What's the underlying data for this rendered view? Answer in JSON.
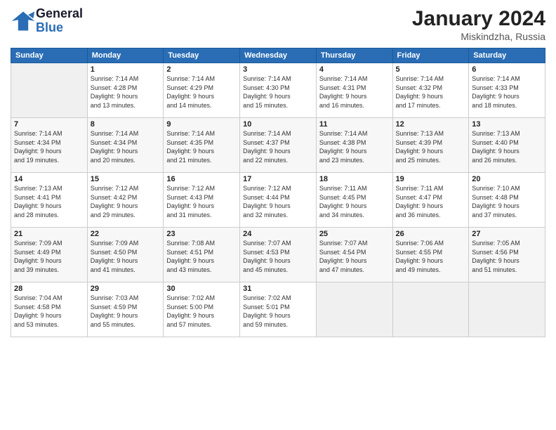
{
  "header": {
    "logo": {
      "line1": "General",
      "line2": "Blue"
    },
    "title": "January 2024",
    "location": "Miskindzha, Russia"
  },
  "calendar": {
    "days_of_week": [
      "Sunday",
      "Monday",
      "Tuesday",
      "Wednesday",
      "Thursday",
      "Friday",
      "Saturday"
    ],
    "weeks": [
      [
        {
          "day": "",
          "info": ""
        },
        {
          "day": "1",
          "info": "Sunrise: 7:14 AM\nSunset: 4:28 PM\nDaylight: 9 hours\nand 13 minutes."
        },
        {
          "day": "2",
          "info": "Sunrise: 7:14 AM\nSunset: 4:29 PM\nDaylight: 9 hours\nand 14 minutes."
        },
        {
          "day": "3",
          "info": "Sunrise: 7:14 AM\nSunset: 4:30 PM\nDaylight: 9 hours\nand 15 minutes."
        },
        {
          "day": "4",
          "info": "Sunrise: 7:14 AM\nSunset: 4:31 PM\nDaylight: 9 hours\nand 16 minutes."
        },
        {
          "day": "5",
          "info": "Sunrise: 7:14 AM\nSunset: 4:32 PM\nDaylight: 9 hours\nand 17 minutes."
        },
        {
          "day": "6",
          "info": "Sunrise: 7:14 AM\nSunset: 4:33 PM\nDaylight: 9 hours\nand 18 minutes."
        }
      ],
      [
        {
          "day": "7",
          "info": "Sunrise: 7:14 AM\nSunset: 4:34 PM\nDaylight: 9 hours\nand 19 minutes."
        },
        {
          "day": "8",
          "info": "Sunrise: 7:14 AM\nSunset: 4:34 PM\nDaylight: 9 hours\nand 20 minutes."
        },
        {
          "day": "9",
          "info": "Sunrise: 7:14 AM\nSunset: 4:35 PM\nDaylight: 9 hours\nand 21 minutes."
        },
        {
          "day": "10",
          "info": "Sunrise: 7:14 AM\nSunset: 4:37 PM\nDaylight: 9 hours\nand 22 minutes."
        },
        {
          "day": "11",
          "info": "Sunrise: 7:14 AM\nSunset: 4:38 PM\nDaylight: 9 hours\nand 23 minutes."
        },
        {
          "day": "12",
          "info": "Sunrise: 7:13 AM\nSunset: 4:39 PM\nDaylight: 9 hours\nand 25 minutes."
        },
        {
          "day": "13",
          "info": "Sunrise: 7:13 AM\nSunset: 4:40 PM\nDaylight: 9 hours\nand 26 minutes."
        }
      ],
      [
        {
          "day": "14",
          "info": "Sunrise: 7:13 AM\nSunset: 4:41 PM\nDaylight: 9 hours\nand 28 minutes."
        },
        {
          "day": "15",
          "info": "Sunrise: 7:12 AM\nSunset: 4:42 PM\nDaylight: 9 hours\nand 29 minutes."
        },
        {
          "day": "16",
          "info": "Sunrise: 7:12 AM\nSunset: 4:43 PM\nDaylight: 9 hours\nand 31 minutes."
        },
        {
          "day": "17",
          "info": "Sunrise: 7:12 AM\nSunset: 4:44 PM\nDaylight: 9 hours\nand 32 minutes."
        },
        {
          "day": "18",
          "info": "Sunrise: 7:11 AM\nSunset: 4:45 PM\nDaylight: 9 hours\nand 34 minutes."
        },
        {
          "day": "19",
          "info": "Sunrise: 7:11 AM\nSunset: 4:47 PM\nDaylight: 9 hours\nand 36 minutes."
        },
        {
          "day": "20",
          "info": "Sunrise: 7:10 AM\nSunset: 4:48 PM\nDaylight: 9 hours\nand 37 minutes."
        }
      ],
      [
        {
          "day": "21",
          "info": "Sunrise: 7:09 AM\nSunset: 4:49 PM\nDaylight: 9 hours\nand 39 minutes."
        },
        {
          "day": "22",
          "info": "Sunrise: 7:09 AM\nSunset: 4:50 PM\nDaylight: 9 hours\nand 41 minutes."
        },
        {
          "day": "23",
          "info": "Sunrise: 7:08 AM\nSunset: 4:51 PM\nDaylight: 9 hours\nand 43 minutes."
        },
        {
          "day": "24",
          "info": "Sunrise: 7:07 AM\nSunset: 4:53 PM\nDaylight: 9 hours\nand 45 minutes."
        },
        {
          "day": "25",
          "info": "Sunrise: 7:07 AM\nSunset: 4:54 PM\nDaylight: 9 hours\nand 47 minutes."
        },
        {
          "day": "26",
          "info": "Sunrise: 7:06 AM\nSunset: 4:55 PM\nDaylight: 9 hours\nand 49 minutes."
        },
        {
          "day": "27",
          "info": "Sunrise: 7:05 AM\nSunset: 4:56 PM\nDaylight: 9 hours\nand 51 minutes."
        }
      ],
      [
        {
          "day": "28",
          "info": "Sunrise: 7:04 AM\nSunset: 4:58 PM\nDaylight: 9 hours\nand 53 minutes."
        },
        {
          "day": "29",
          "info": "Sunrise: 7:03 AM\nSunset: 4:59 PM\nDaylight: 9 hours\nand 55 minutes."
        },
        {
          "day": "30",
          "info": "Sunrise: 7:02 AM\nSunset: 5:00 PM\nDaylight: 9 hours\nand 57 minutes."
        },
        {
          "day": "31",
          "info": "Sunrise: 7:02 AM\nSunset: 5:01 PM\nDaylight: 9 hours\nand 59 minutes."
        },
        {
          "day": "",
          "info": ""
        },
        {
          "day": "",
          "info": ""
        },
        {
          "day": "",
          "info": ""
        }
      ]
    ]
  }
}
